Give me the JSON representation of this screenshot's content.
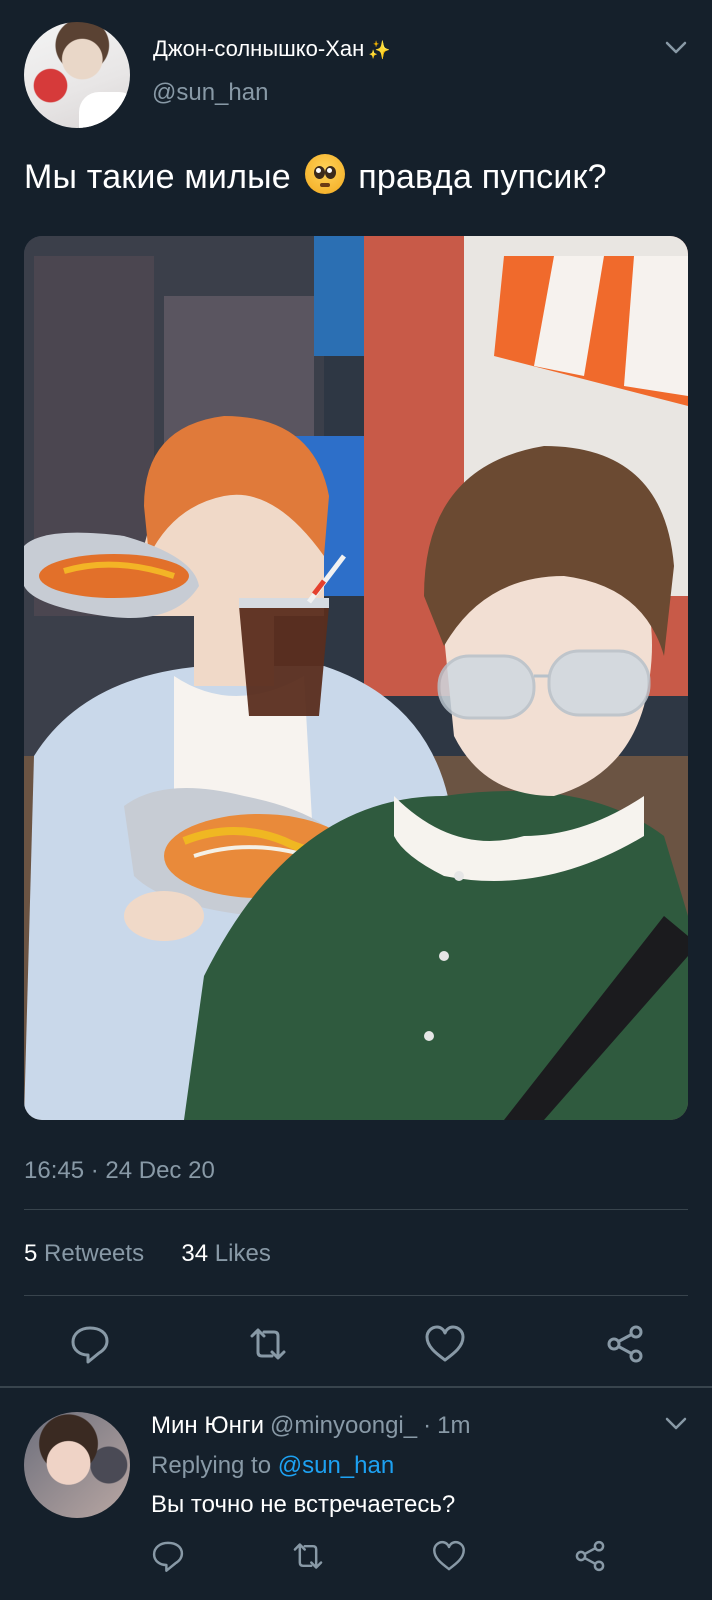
{
  "tweet": {
    "display_name": "Джон-солнышко-Хан",
    "name_emoji": "sparkles-emoji",
    "handle": "@sun_han",
    "text_before": "Мы такие милые",
    "text_emoji": "pleading-face-emoji",
    "text_after": "правда пупсик?",
    "photo_icon": "photo-of-two-people-with-hot-dogs",
    "time": "16:45 · 24 Dec 20",
    "retweets_count": "5",
    "retweets_label": "Retweets",
    "likes_count": "34",
    "likes_label": "Likes",
    "actions": [
      "reply-icon",
      "retweet-icon",
      "like-icon",
      "share-icon"
    ]
  },
  "reply": {
    "name": "Мин Юнги",
    "handle": "@minyoongi_",
    "time": "1m",
    "replying_prefix": "Replying to",
    "replying_to": "@sun_han",
    "text": "Вы точно не встречаетесь?",
    "actions": [
      "reply-icon",
      "retweet-icon",
      "like-icon",
      "share-icon"
    ]
  },
  "colors": {
    "background": "#15202b",
    "secondary_text": "#8899a6",
    "link": "#1da1f2",
    "divider": "#38444d"
  }
}
